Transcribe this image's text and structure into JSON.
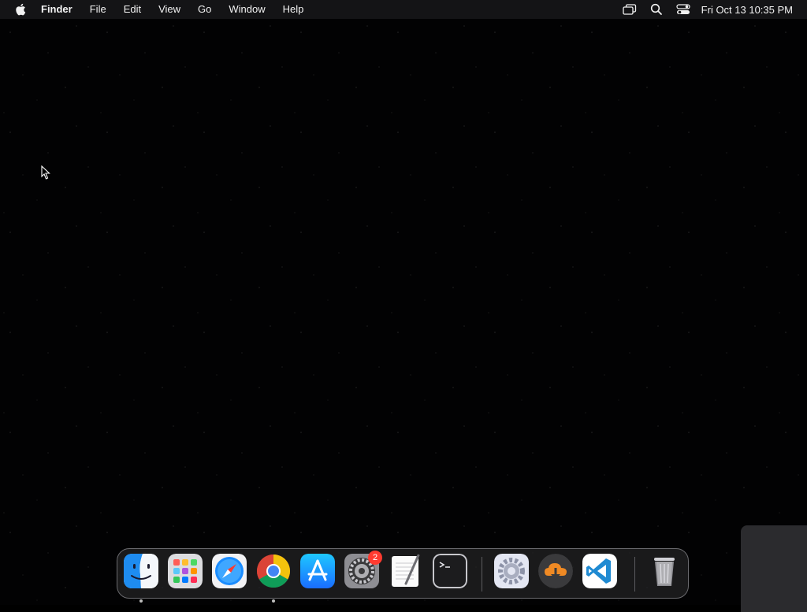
{
  "menubar": {
    "app_name": "Finder",
    "menus": [
      "File",
      "Edit",
      "View",
      "Go",
      "Window",
      "Help"
    ],
    "status_icons": [
      "screen-mirroring-icon",
      "spotlight-search-icon",
      "control-center-icon"
    ],
    "clock": "Fri Oct 13  10:35 PM"
  },
  "dock": {
    "apps": [
      {
        "name": "Finder",
        "icon": "finder-icon",
        "running": true
      },
      {
        "name": "Launchpad",
        "icon": "launchpad-icon",
        "running": false
      },
      {
        "name": "Safari",
        "icon": "safari-icon",
        "running": false
      },
      {
        "name": "Google Chrome",
        "icon": "chrome-icon",
        "running": true
      },
      {
        "name": "App Store",
        "icon": "app-store-icon",
        "running": false
      },
      {
        "name": "System Settings",
        "icon": "system-settings-icon",
        "running": false,
        "badge": "2"
      },
      {
        "name": "TextEdit",
        "icon": "textedit-icon",
        "running": false
      },
      {
        "name": "Terminal",
        "icon": "terminal-icon",
        "running": false
      },
      {
        "name": "Utility Settings",
        "icon": "gear-app-icon",
        "running": false
      },
      {
        "name": "Downloader",
        "icon": "cloud-download-icon",
        "running": false
      },
      {
        "name": "Visual Studio Code",
        "icon": "vscode-icon",
        "running": false
      },
      {
        "name": "Trash",
        "icon": "trash-icon",
        "running": false
      }
    ]
  },
  "colors": {
    "menubar_bg": "#141416",
    "desktop_bg": "#020203",
    "badge": "#ff3b30"
  }
}
